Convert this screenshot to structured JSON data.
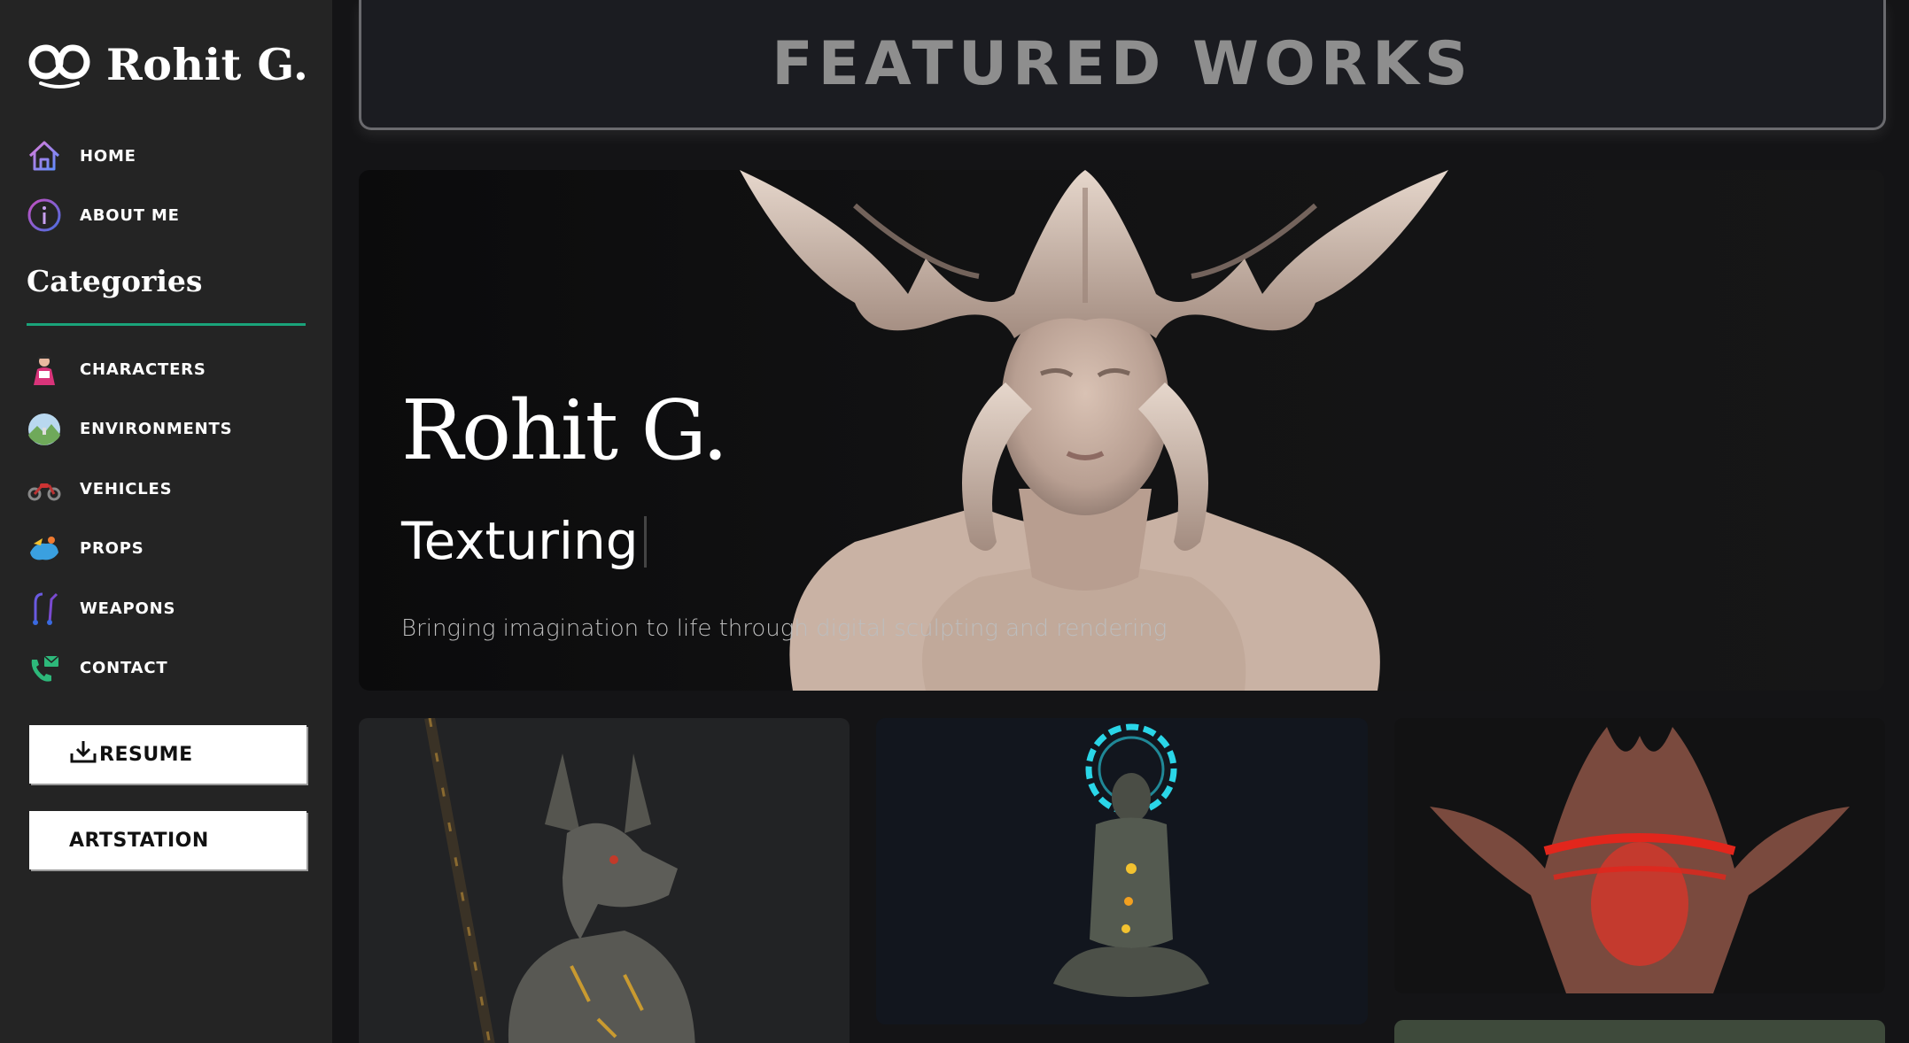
{
  "brand": {
    "name": "Rohit G.",
    "logo_icon": "infinity-icon"
  },
  "nav": {
    "home": "HOME",
    "about": "ABOUT ME"
  },
  "categories": {
    "heading": "Categories",
    "accent_color": "#1aa37a",
    "items": [
      {
        "label": "CHARACTERS",
        "icon": "character-icon"
      },
      {
        "label": "ENVIRONMENTS",
        "icon": "landscape-icon"
      },
      {
        "label": "VEHICLES",
        "icon": "motorcycle-icon"
      },
      {
        "label": "PROPS",
        "icon": "props-icon"
      },
      {
        "label": "WEAPONS",
        "icon": "weapons-icon"
      },
      {
        "label": "CONTACT",
        "icon": "phone-mail-icon"
      }
    ]
  },
  "buttons": {
    "resume": "RESUME",
    "artstation": "ARTSTATION"
  },
  "main": {
    "featured_title": "FEATURED WORKS",
    "hero": {
      "name": "Rohit G.",
      "role": "Texturing",
      "tagline": "Bringing imagination to life through digital sculpting and rendering"
    }
  }
}
